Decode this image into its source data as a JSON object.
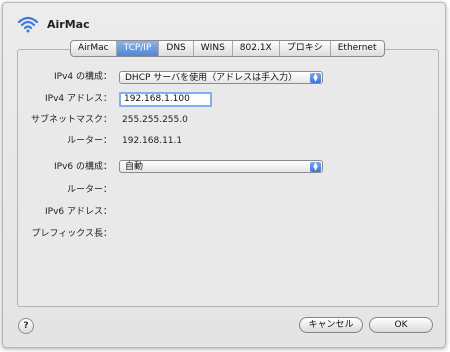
{
  "app": {
    "title": "AirMac"
  },
  "tabs": [
    {
      "label": "AirMac",
      "active": false
    },
    {
      "label": "TCP/IP",
      "active": true
    },
    {
      "label": "DNS",
      "active": false
    },
    {
      "label": "WINS",
      "active": false
    },
    {
      "label": "802.1X",
      "active": false
    },
    {
      "label": "プロキシ",
      "active": false
    },
    {
      "label": "Ethernet",
      "active": false
    }
  ],
  "ipv4": {
    "config_label": "IPv4 の構成：",
    "config_value": "DHCP サーバを使用（アドレスは手入力）",
    "address_label": "IPv4 アドレス：",
    "address_value": "192.168.1.100",
    "subnet_label": "サブネットマスク：",
    "subnet_value": "255.255.255.0",
    "router_label": "ルーター：",
    "router_value": "192.168.11.1"
  },
  "ipv6": {
    "config_label": "IPv6 の構成：",
    "config_value": "自動",
    "router_label": "ルーター：",
    "address_label": "IPv6 アドレス：",
    "prefix_label": "プレフィックス長："
  },
  "buttons": {
    "help": "?",
    "cancel": "キャンセル",
    "ok": "OK"
  },
  "colors": {
    "accent": "#4f87d6",
    "focus_ring": "#84aef0"
  }
}
